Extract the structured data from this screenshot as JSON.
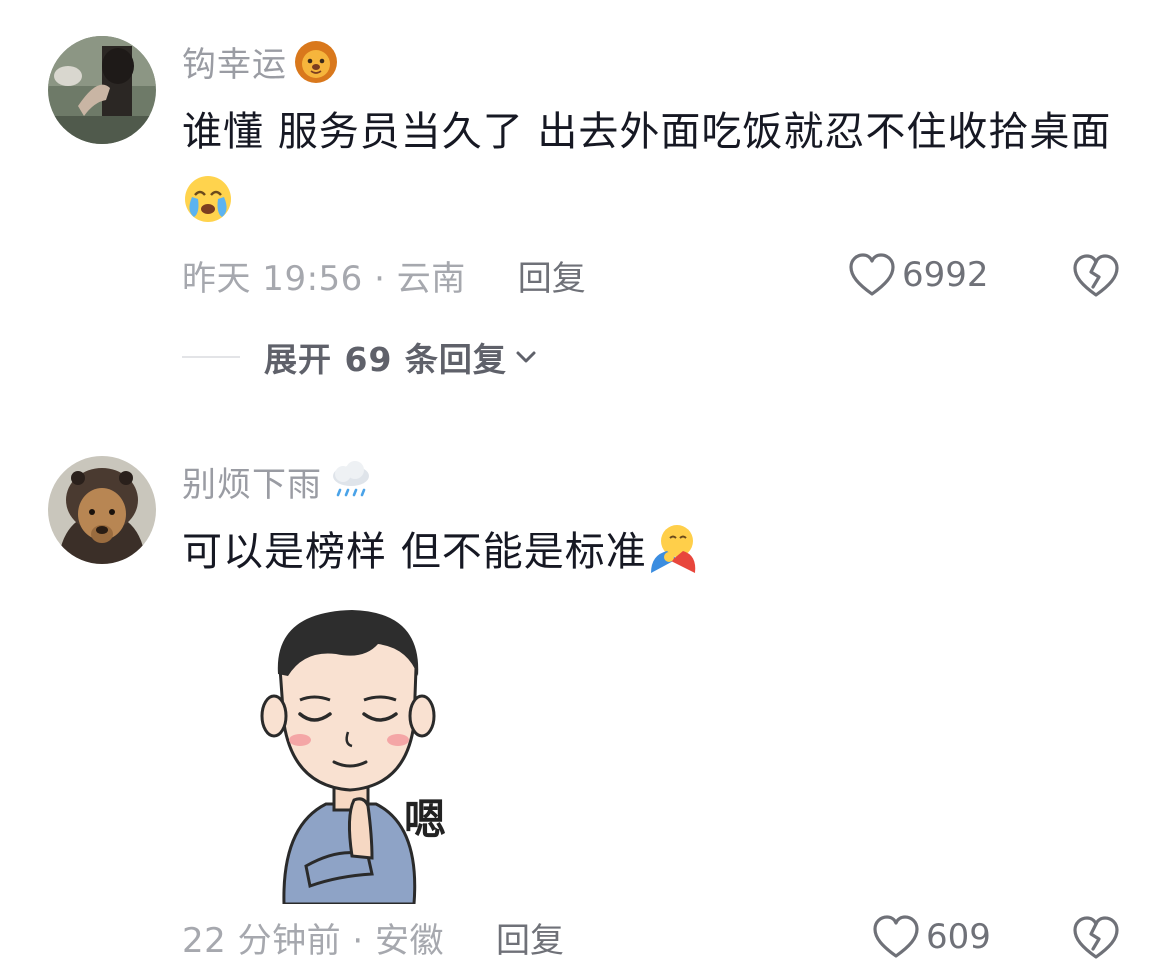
{
  "comments": [
    {
      "username": "钩幸运",
      "name_emoji": "lion-face-emoji",
      "text": "谁懂 服务员当久了  出去外面吃饭就忍不住收拾桌面",
      "text_emoji": "crying-face-emoji",
      "time_location": "昨天 19:56 · 云南",
      "reply_label": "回复",
      "likes": "6992",
      "expand_replies": "展开 69 条回复"
    },
    {
      "username": "别烦下雨",
      "name_emoji": "rain-cloud-emoji",
      "text": "可以是榜样 但不能是标准",
      "text_emoji": "hugging-face-emoji",
      "sticker_text": "嗯",
      "time_location": "22 分钟前 · 安徽",
      "reply_label": "回复",
      "likes": "609"
    }
  ],
  "colors": {
    "username": "#9a9ca3",
    "comment_text": "#161823",
    "meta": "#a6a8ae",
    "action": "#6f7178"
  }
}
